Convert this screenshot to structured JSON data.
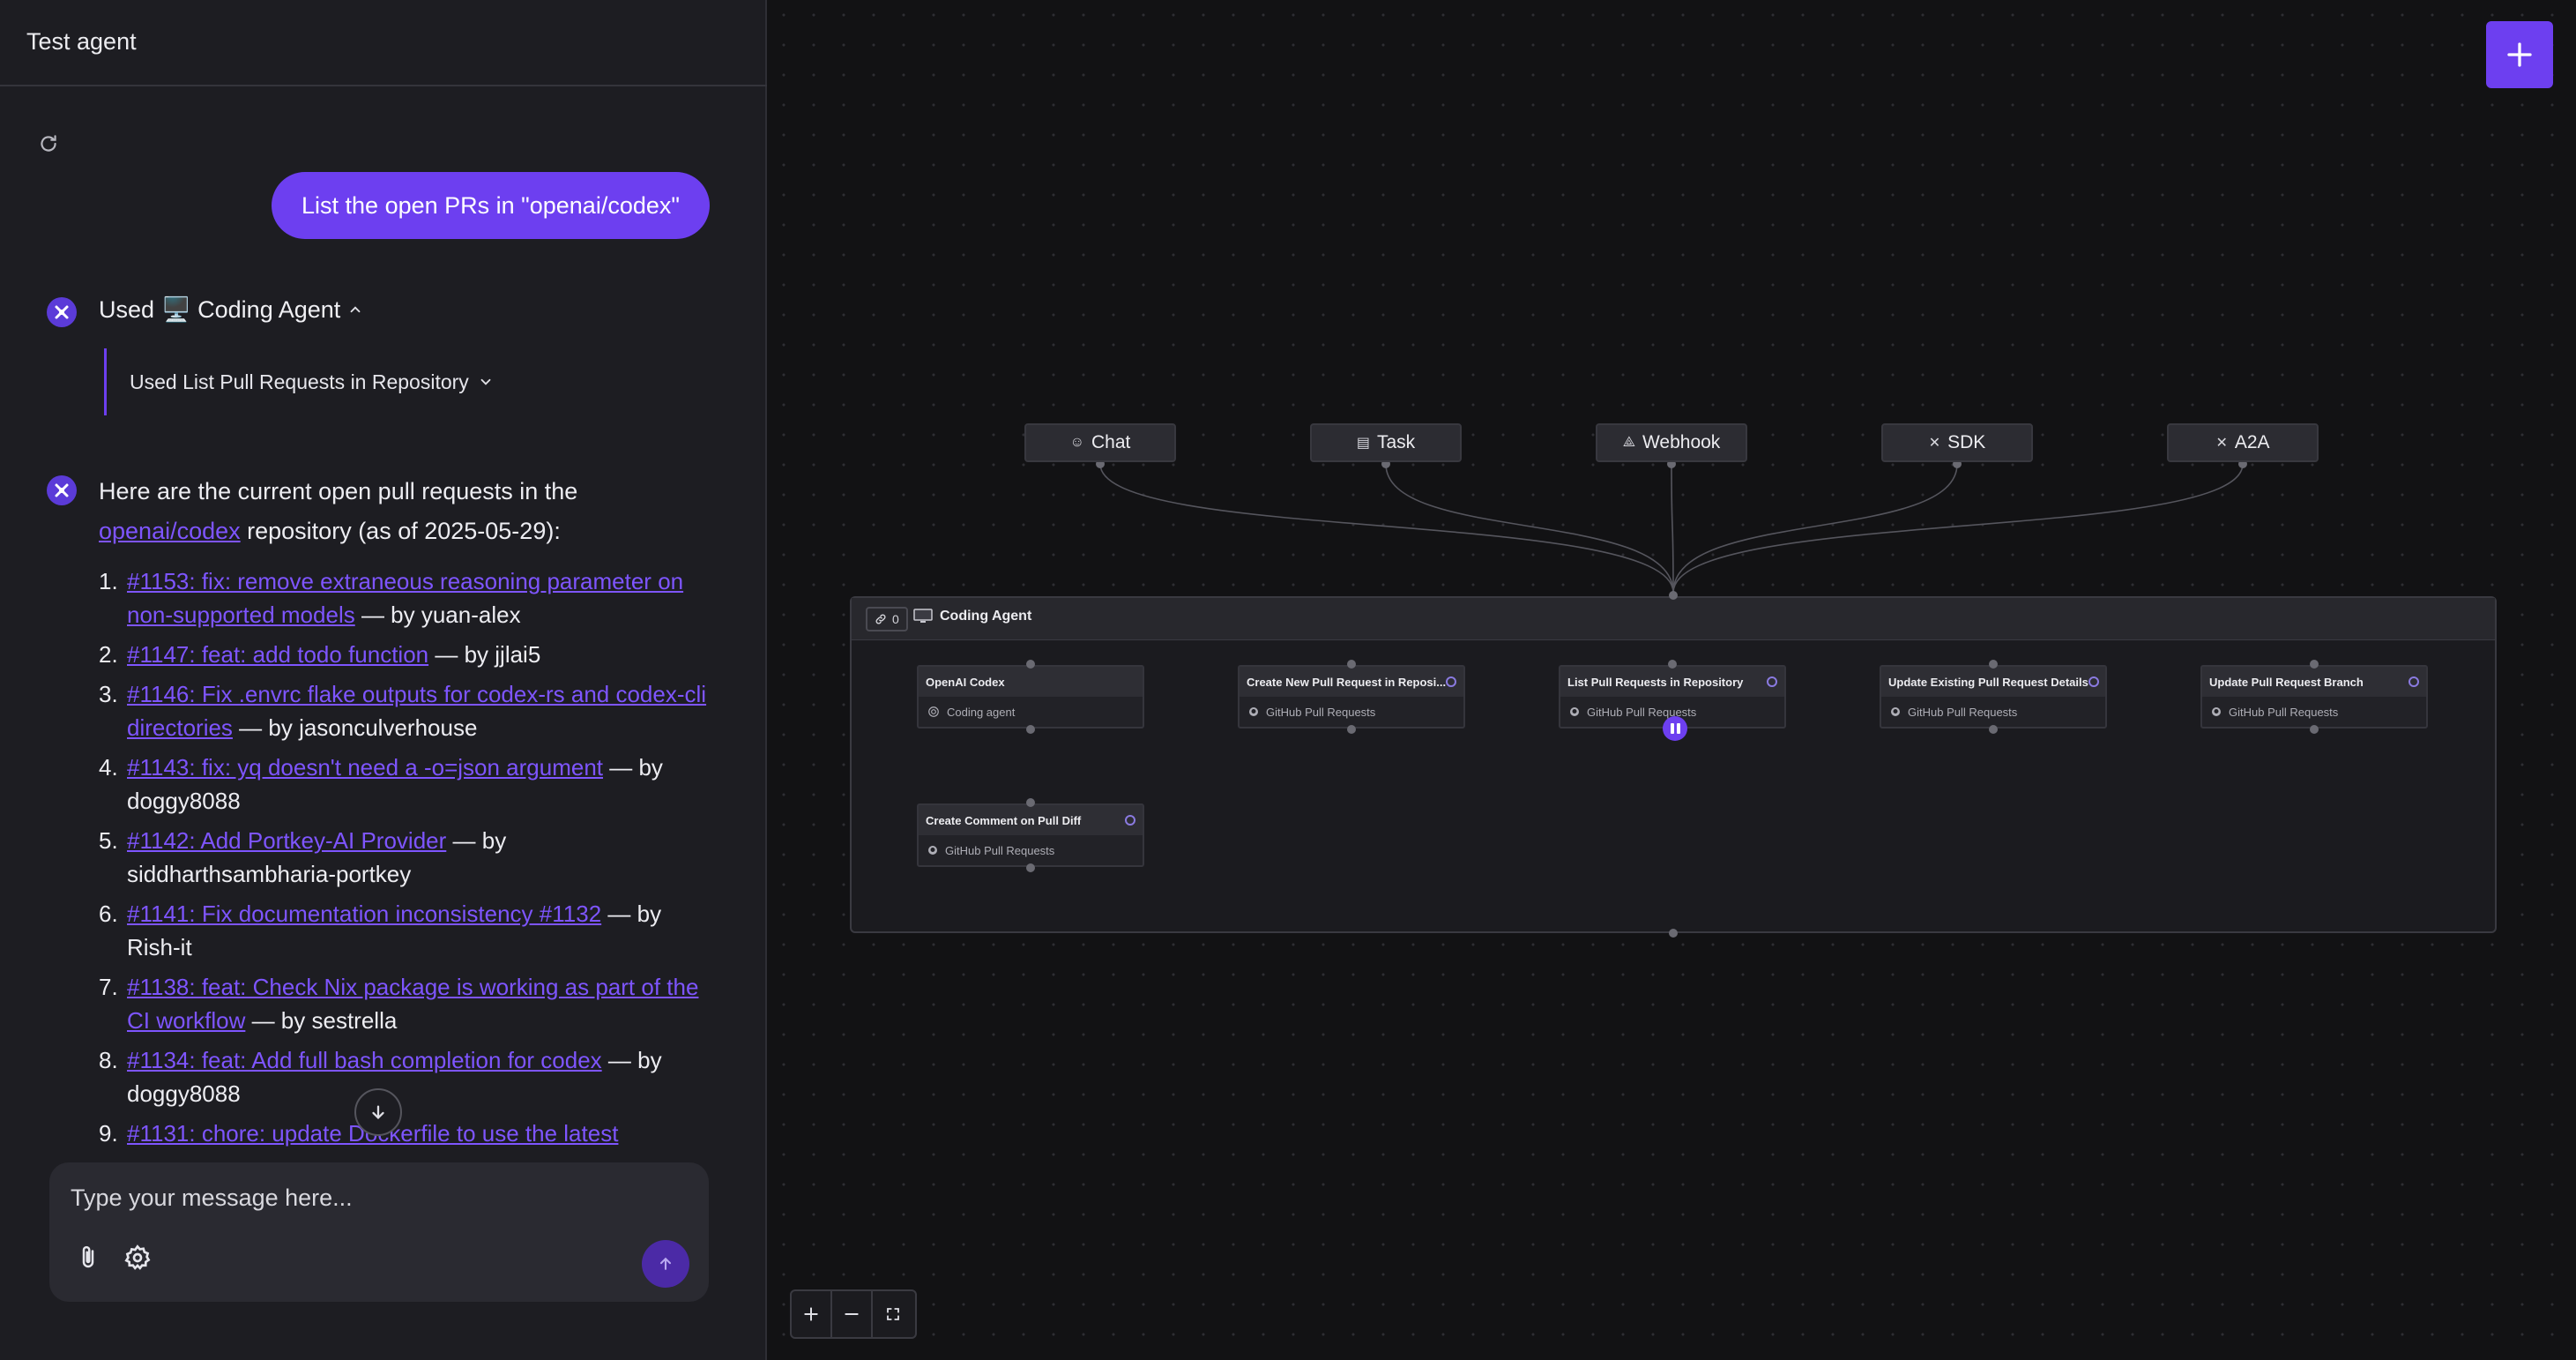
{
  "chat": {
    "title": "Test agent",
    "user_message": "List the open PRs in \"openai/codex\"",
    "tool_used_prefix": "Used",
    "tool_used_name": "🖥️ Coding Agent",
    "sub_tool_used": "Used List Pull Requests in Repository",
    "answer_intro_1": "Here are the current open pull requests in the",
    "answer_repo_link": "openai/codex",
    "answer_intro_2": " repository (as of 2025-05-29):",
    "pull_requests": [
      {
        "num": "1.",
        "link": "#1153: fix: remove extraneous reasoning parameter on non-supported models",
        "author": " — by yuan-alex"
      },
      {
        "num": "2.",
        "link": "#1147: feat: add todo function",
        "author": " — by jjlai5"
      },
      {
        "num": "3.",
        "link": "#1146: Fix .envrc flake outputs for codex-rs and codex-cli directories",
        "author": " — by jasonculverhouse"
      },
      {
        "num": "4.",
        "link": "#1143: fix: yq doesn't need a -o=json argument",
        "author": " — by doggy8088"
      },
      {
        "num": "5.",
        "link": "#1142: Add Portkey-AI Provider",
        "author": " — by siddharthsambharia-portkey"
      },
      {
        "num": "6.",
        "link": "#1141: Fix documentation inconsistency #1132",
        "author": " — by Rish-it"
      },
      {
        "num": "7.",
        "link": "#1138: feat: Check Nix package is working as part of the CI workflow",
        "author": " — by sestrella"
      },
      {
        "num": "8.",
        "link": "#1134: feat: Add full bash completion for codex",
        "author": " — by doggy8088"
      },
      {
        "num": "9.",
        "link": "#1131: chore: update Dockerfile to use the latest",
        "author": ""
      }
    ],
    "composer_placeholder": "Type your message here..."
  },
  "canvas": {
    "triggers": [
      {
        "label": "Chat",
        "icon": "chat-icon"
      },
      {
        "label": "Task",
        "icon": "calendar-icon"
      },
      {
        "label": "Webhook",
        "icon": "webhook-icon"
      },
      {
        "label": "SDK",
        "icon": "sdk-icon"
      },
      {
        "label": "A2A",
        "icon": "a2a-icon"
      }
    ],
    "agent": {
      "link_count": "0",
      "name": "Coding Agent",
      "icon": "monitor-icon"
    },
    "tools": [
      {
        "title": "OpenAI Codex",
        "subtitle": "Coding agent",
        "settings": false
      },
      {
        "title": "Create New Pull Request in Reposi...",
        "subtitle": "GitHub Pull Requests",
        "settings": true
      },
      {
        "title": "List Pull Requests in Repository",
        "subtitle": "GitHub Pull Requests",
        "settings": true
      },
      {
        "title": "Update Existing Pull Request Details",
        "subtitle": "GitHub Pull Requests",
        "settings": true
      },
      {
        "title": "Update Pull Request Branch",
        "subtitle": "GitHub Pull Requests",
        "settings": true
      },
      {
        "title": "Create Comment on Pull Diff",
        "subtitle": "GitHub Pull Requests",
        "settings": true
      }
    ]
  },
  "colors": {
    "accent": "#6d3ff0",
    "link": "#7e55ff",
    "panel": "#1d1d22",
    "canvas": "#121214"
  }
}
